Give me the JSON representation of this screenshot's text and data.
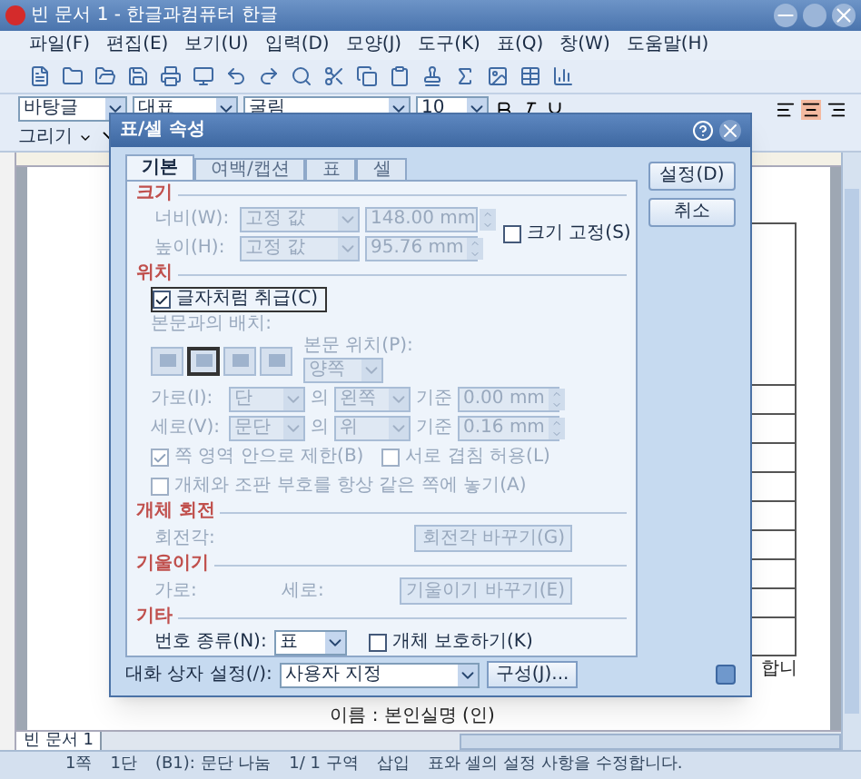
{
  "window": {
    "title": "빈 문서 1 - 한글과컴퓨터 한글"
  },
  "menu": [
    "파일(F)",
    "편집(E)",
    "보기(U)",
    "입력(D)",
    "모양(J)",
    "도구(K)",
    "표(Q)",
    "창(W)",
    "도움말(H)"
  ],
  "format_bar": {
    "style": "바탕글",
    "language": "대표",
    "font": "굴림",
    "size": "10"
  },
  "drawing_bar": {
    "label": "그리기"
  },
  "document": {
    "text_right": "합니",
    "signature": "이름 : 본인실명 (인)",
    "tab": "빈 문서 1"
  },
  "status_bar": [
    "1쪽",
    "1단",
    "(B1): 문단 나눔",
    "1/ 1 구역",
    "삽입",
    "표와 셀의 설정 사항을 수정합니다."
  ],
  "dialog": {
    "title": "표/셀 속성",
    "tabs": [
      {
        "label": "기본",
        "selected": true
      },
      {
        "label": "여백/캡션",
        "selected": false
      },
      {
        "label": "표",
        "selected": false
      },
      {
        "label": "셀",
        "selected": false
      }
    ],
    "buttons": [
      {
        "label": "설정(D)"
      },
      {
        "label": "취소"
      }
    ],
    "size": {
      "title": "크기",
      "rows": [
        {
          "label": "너비(W):",
          "mode": "고정 값",
          "value": "148.00 mm",
          "disabled": true
        },
        {
          "label": "높이(H):",
          "mode": "고정 값",
          "value": "95.76 mm",
          "disabled": true
        }
      ],
      "fix": {
        "label": "크기 고정(S)",
        "checked": false,
        "disabled": false
      }
    },
    "position": {
      "title": "위치",
      "treat_as_char": {
        "label": "글자처럼 취급(C)",
        "checked": true,
        "disabled": false
      },
      "wrap_label": "본문과의 배치:",
      "wrap_options": [
        {
          "selected": false
        },
        {
          "selected": true
        },
        {
          "selected": false
        },
        {
          "selected": false
        }
      ],
      "text_pos_label": "본문 위치(P):",
      "text_pos": "양쪽",
      "disabled": true,
      "rows": [
        {
          "label": "가로(I):",
          "ref": "단",
          "of": "의",
          "align": "왼쪽",
          "base": "기준",
          "offset": "0.00 mm"
        },
        {
          "label": "세로(V):",
          "ref": "문단",
          "of": "의",
          "align": "위",
          "base": "기준",
          "offset": "0.16 mm"
        }
      ],
      "checks": [
        {
          "label": "쪽 영역 안으로 제한(B)",
          "checked": true,
          "disabled": true
        },
        {
          "label": "서로 겹침 허용(L)",
          "checked": false,
          "disabled": true
        },
        {
          "label": "개체와 조판 부호를 항상 같은 쪽에 놓기(A)",
          "checked": false,
          "disabled": true
        }
      ]
    },
    "rotation": {
      "title": "개체 회전",
      "label": "회전각:",
      "button": "회전각 바꾸기(G)",
      "disabled": true
    },
    "skew": {
      "title": "기울이기",
      "horizontal": "가로:",
      "vertical": "세로:",
      "button": "기울이기 바꾸기(E)",
      "disabled": true
    },
    "other": {
      "title": "기타",
      "number_label": "번호 종류(N):",
      "number_type": "표",
      "protect": {
        "label": "개체 보호하기(K)",
        "checked": false,
        "disabled": false
      }
    },
    "footer": {
      "label": "대화 상자 설정(/):",
      "preset": "사용자 지정",
      "button": "구성(J)..."
    }
  }
}
